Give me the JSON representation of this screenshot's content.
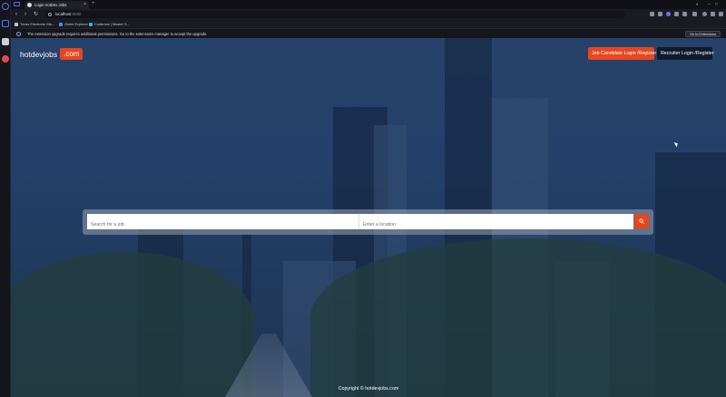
{
  "browser": {
    "tab": {
      "title": "Login HotDev Jobs"
    },
    "address": {
      "host": "localhost",
      "port": ":8080"
    },
    "bookmarks": [
      {
        "label": "Texas Electronic Ma...",
        "color": "#c9c9d2"
      },
      {
        "label": "Globe Explorer",
        "color": "#4f8df7"
      },
      {
        "label": "Coderrow | Master S...",
        "color": "#35b3e8"
      }
    ],
    "notice": {
      "message": "The extension upgrade requires additional permissions. Go to the extensions manager to accept the upgrade.",
      "button": "Go to Extensions"
    }
  },
  "site": {
    "logo": {
      "name": "hotdevjobs",
      "suffix": ".com"
    },
    "header": {
      "candidate_button": "Job Candidate Login /Register",
      "recruiter_button": "Recruiter Login /Register"
    },
    "search": {
      "job_placeholder": "Search for a job",
      "location_placeholder": "Enter a location"
    },
    "footer": {
      "copyright": "Copyright © hotdevjobs.com"
    },
    "colors": {
      "accent": "#e8461e",
      "overlay": "#24406a",
      "recruiter_button": "#0f1a2c"
    }
  }
}
